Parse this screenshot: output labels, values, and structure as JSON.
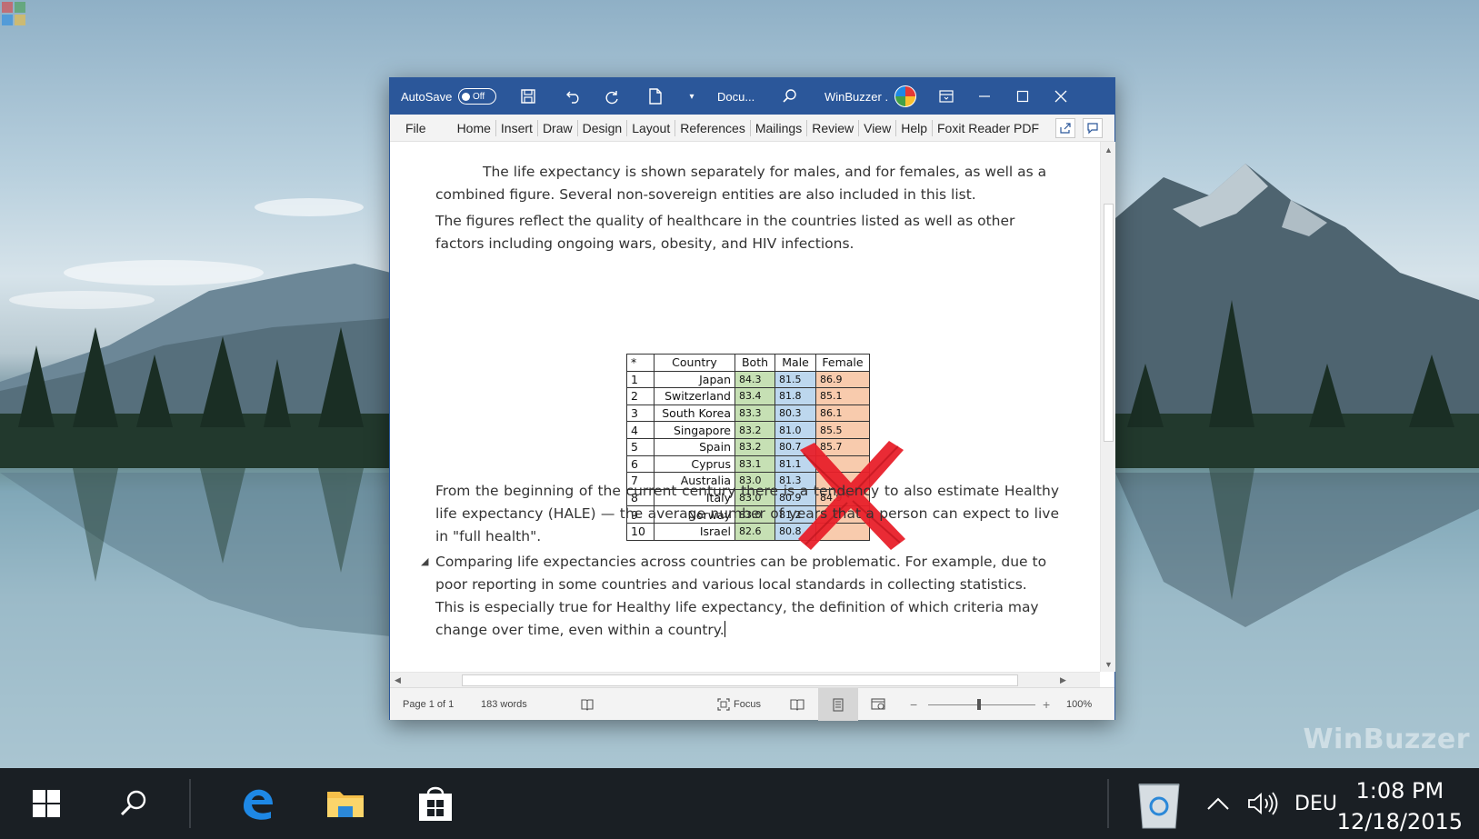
{
  "desktop": {
    "watermark": "WinBuzzer"
  },
  "word": {
    "titlebar": {
      "autosave_label": "AutoSave",
      "autosave_state": "Off",
      "doc_title": "Docu...",
      "user_name": "WinBuzzer ."
    },
    "ribbon": {
      "tabs": [
        "File",
        "Home",
        "Insert",
        "Draw",
        "Design",
        "Layout",
        "References",
        "Mailings",
        "Review",
        "View",
        "Help",
        "Foxit Reader PDF"
      ]
    },
    "document": {
      "para1": "The life expectancy is shown separately for males, and for females, as well as a combined figure. Several non-sovereign entities are also included in this list.",
      "para2": "The figures reflect the quality of healthcare in the countries listed as well as other factors including ongoing wars, obesity, and HIV infections.",
      "para3": "From the beginning of the current century there is a tendency to also estimate Healthy life expectancy (HALE) — the average number of years that a person can expect to live in \"full health\".",
      "para4": "Comparing life expectancies across countries can be problematic. For example, due to poor reporting in some countries and various local standards in collecting statistics. This is especially true for Healthy life expectancy, the definition of which criteria may change over time, even within a country.",
      "table": {
        "headers": [
          "*",
          "Country",
          "Both",
          "Male",
          "Female"
        ],
        "rows": [
          [
            "1",
            "Japan",
            "84.3",
            "81.5",
            "86.9"
          ],
          [
            "2",
            "Switzerland",
            "83.4",
            "81.8",
            "85.1"
          ],
          [
            "3",
            "South Korea",
            "83.3",
            "80.3",
            "86.1"
          ],
          [
            "4",
            "Singapore",
            "83.2",
            "81.0",
            "85.5"
          ],
          [
            "5",
            "Spain",
            "83.2",
            "80.7",
            "85.7"
          ],
          [
            "6",
            "Cyprus",
            "83.1",
            "81.1",
            ""
          ],
          [
            "7",
            "Australia",
            "83.0",
            "81.3",
            ""
          ],
          [
            "8",
            "Italy",
            "83.0",
            "80.9",
            "84.9"
          ],
          [
            "9",
            "Norway",
            "83.0",
            "81.2",
            "8"
          ],
          [
            "10",
            "Israel",
            "82.6",
            "80.8",
            ""
          ]
        ]
      }
    },
    "statusbar": {
      "page": "Page 1 of 1",
      "words": "183 words",
      "focus": "Focus",
      "zoom": "100%",
      "zoom_level": 0.47
    }
  },
  "taskbar": {
    "language": "DEU",
    "time": "1:08 PM",
    "date": "12/18/2015"
  },
  "colors": {
    "word_blue": "#2b579a",
    "taskbar": "#1a1f24",
    "both_cell": "#c6e0b4",
    "male_cell": "#bdd7ee",
    "female_cell": "#f8cbad",
    "red_x": "#e8202a"
  }
}
